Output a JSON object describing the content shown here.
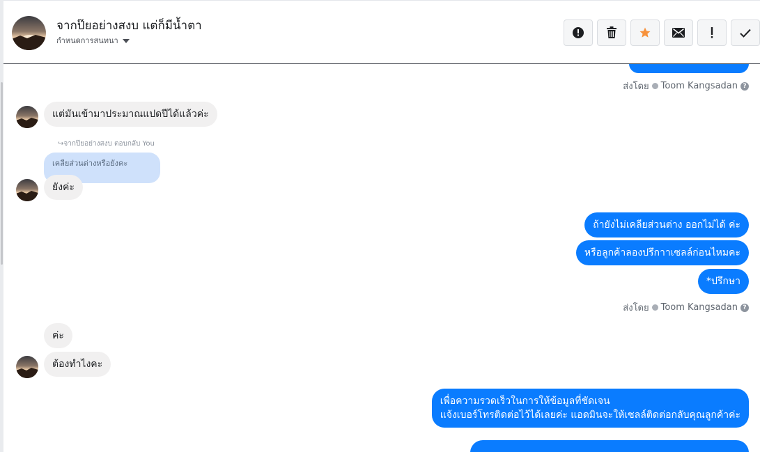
{
  "header": {
    "title": "จากป๊ยอย่างสงบ แต่ก็มีน้ำตา",
    "subtitle": "กำหนดการสนทนา"
  },
  "actions": [
    {
      "name": "report-button",
      "icon": "alert-circle-icon",
      "glyph": "!"
    },
    {
      "name": "delete-button",
      "icon": "trash-icon",
      "glyph": ""
    },
    {
      "name": "star-button",
      "icon": "star-icon",
      "glyph": "★"
    },
    {
      "name": "mark-unread-button",
      "icon": "envelope-icon",
      "glyph": ""
    },
    {
      "name": "follow-up-button",
      "icon": "exclamation-icon",
      "glyph": "!"
    },
    {
      "name": "mark-done-button",
      "icon": "checkmark-icon",
      "glyph": "✓"
    }
  ],
  "colors": {
    "outgoing": "#0a7cff",
    "incoming": "#f1f0f0",
    "quote": "#cfe1fb",
    "star": "#f7923b"
  },
  "messages": {
    "m0_partial": "แต่มันเข้ามาประมาณแปดปีได้แล้วค่ะ",
    "m1": "แต่มันเข้ามาประมาณแปดปีได้แล้วค่ะ",
    "reply_meta": "จากป๊ยอย่างสงบ ตอบกลับ You",
    "quote": "เคลียส่วนต่างหรือยังคะ",
    "m2": "ยังค่ะ",
    "out1": "ถ้ายังไม่เคลียส่วนต่าง ออกไม่ได้ ค่ะ",
    "out2": "หรือลูกค้าลองปรึกาาเซลล์ก่อนไหมคะ",
    "out3": "*ปรึกษา",
    "m3": "ค่ะ",
    "m4": "ต้องทำไงคะ",
    "out4_line1": "เพื่อความรวดเร็วในการให้ข้อมูลที่ชัดเจน",
    "out4_line2": "แจ้งเบอร์โทรติดต่อไว้ได้เลยค่ะ แอดมินจะให้เซลล์ติดต่อกลับคุณลูกค้าค่ะ"
  },
  "sent_by": {
    "prefix": "ส่งโดย",
    "name": "Toom Kangsadan",
    "help": "?"
  }
}
